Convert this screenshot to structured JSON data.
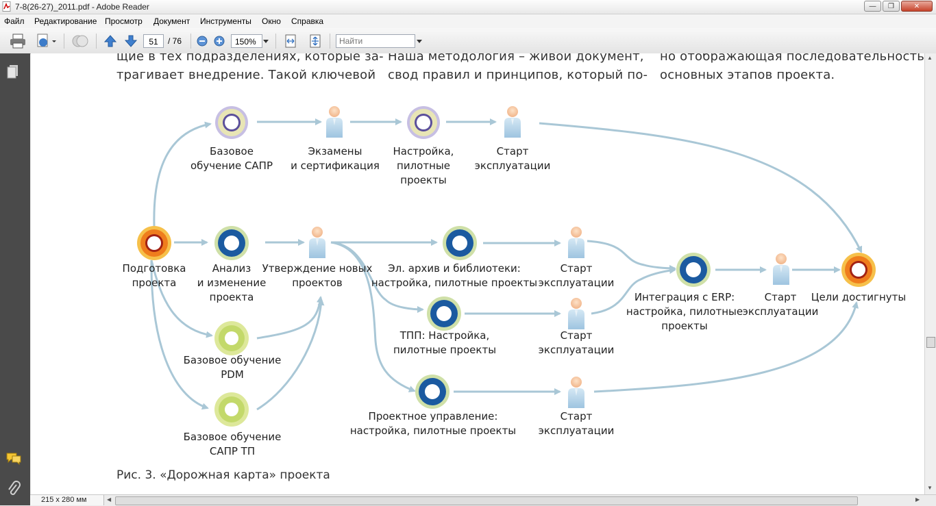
{
  "window": {
    "title": "7-8(26-27)_2011.pdf - Adobe Reader"
  },
  "menu": [
    "Файл",
    "Редактирование",
    "Просмотр",
    "Документ",
    "Инструменты",
    "Окно",
    "Справка"
  ],
  "toolbar": {
    "page_number": "51",
    "page_total": "/ 76",
    "zoom": "150%",
    "search_placeholder": "Найти"
  },
  "status": {
    "page_size": "215 x 280 мм"
  },
  "body_text": {
    "col1": [
      "щие в тех подразделениях, которые за-",
      "трагивает внедрение. Такой ключевой"
    ],
    "col2": [
      "Наша методология – живой документ,",
      "свод правил и принципов, который по-"
    ],
    "col3": [
      "но отображающая последовательность",
      "основных этапов проекта."
    ]
  },
  "diagram": {
    "labels": {
      "bazovoe_sapr": "Базовое\nобучение САПР",
      "ekzameny": "Экзамены\nи сертификация",
      "nastroika": "Настройка,\nпилотные\nпроекты",
      "start1": "Старт\nэксплуатации",
      "podgotovka": "Подготовка\nпроекта",
      "analiz": "Анализ\nи изменение\nпроекта",
      "utverzhdenie": "Утверждение новых\nпроектов",
      "el_arhiv": "Эл. архив и библиотеки:\nнастройка, пилотные проекты",
      "start2": "Старт\nэксплуатации",
      "erp": "Интеграция с ERP:\nнастройка, пилотные\nпроекты",
      "start_erp": "Старт\nэксплуатации",
      "celi": "Цели достигнуты",
      "tpp": "ТПП: Настройка,\nпилотные проекты",
      "start3": "Старт\nэксплуатации",
      "pdm": "Базовое обучение\nPDM",
      "sapr_tp": "Базовое обучение\nСАПР ТП",
      "pm": "Проектное управление:\nнастройка, пилотные проекты",
      "start4": "Старт\nэксплуатации"
    }
  },
  "caption": "Рис. 3. «Дорожная карта» проекта",
  "colors": {
    "arrow": "#a9c7d6",
    "orange": "#f08a24",
    "violet": "#c7bfe3",
    "blue": "#1b5aa0",
    "lime": "#d3e38a",
    "panel": "#4a4a4a"
  }
}
